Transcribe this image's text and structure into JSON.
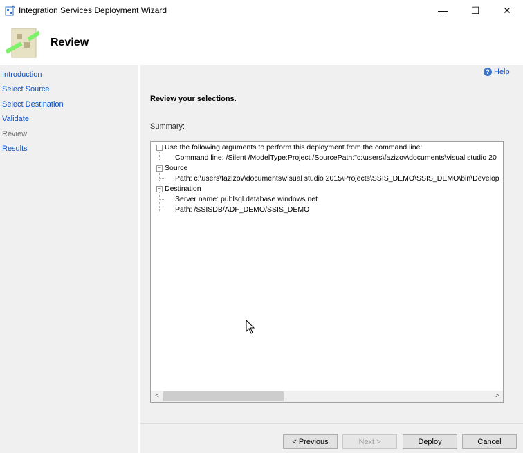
{
  "window": {
    "title": "Integration Services Deployment Wizard",
    "minimize": "—",
    "maximize": "☐",
    "close": "✕"
  },
  "header": {
    "title": "Review"
  },
  "nav": {
    "items": [
      {
        "label": "Introduction"
      },
      {
        "label": "Select Source"
      },
      {
        "label": "Select Destination"
      },
      {
        "label": "Validate"
      },
      {
        "label": "Review"
      },
      {
        "label": "Results"
      }
    ]
  },
  "main": {
    "help": "Help",
    "heading": "Review your selections.",
    "summary_label": "Summary:"
  },
  "summary": {
    "g1": "Use the following arguments to perform this deployment from the command line:",
    "g1c1": "Command line: /Silent /ModelType:Project /SourcePath:\"c:\\users\\fazizov\\documents\\visual studio 20",
    "g2": "Source",
    "g2c1": "Path: c:\\users\\fazizov\\documents\\visual studio 2015\\Projects\\SSIS_DEMO\\SSIS_DEMO\\bin\\Develop",
    "g3": "Destination",
    "g3c1": "Server name: publsql.database.windows.net",
    "g3c2": "Path: /SSISDB/ADF_DEMO/SSIS_DEMO"
  },
  "buttons": {
    "previous": "< Previous",
    "next": "Next >",
    "deploy": "Deploy",
    "cancel": "Cancel"
  }
}
